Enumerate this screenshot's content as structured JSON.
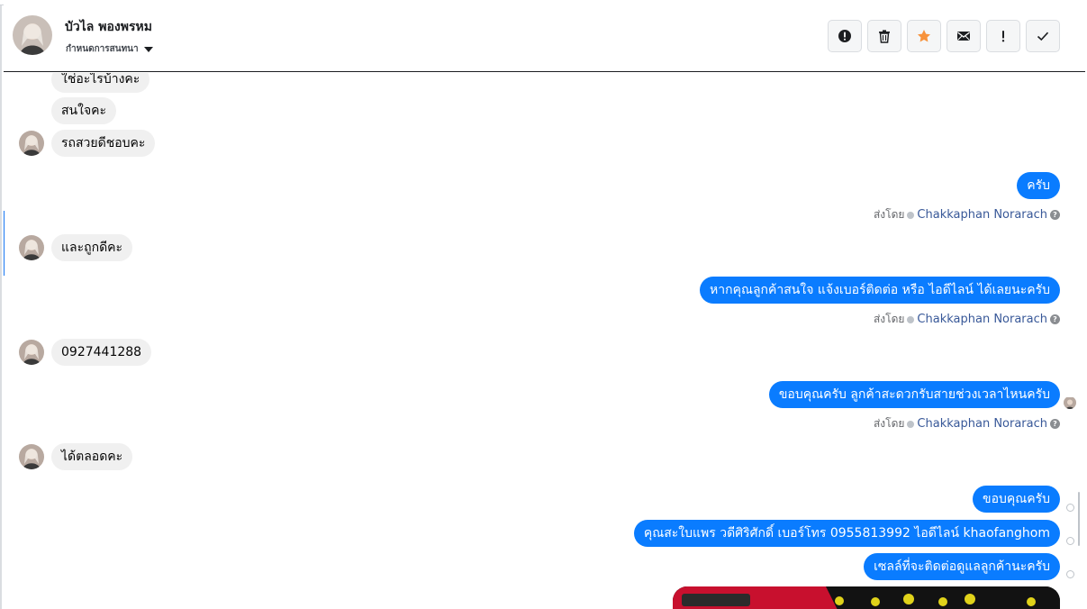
{
  "header": {
    "contact_name": "บัวไล พองพรหม",
    "assign_label": "กำหนดการสนทนา",
    "actions": [
      {
        "name": "spam-button",
        "icon": "alert-circle-icon"
      },
      {
        "name": "delete-button",
        "icon": "trash-icon"
      },
      {
        "name": "star-button",
        "icon": "star-icon",
        "color": "#f7923b"
      },
      {
        "name": "mark-unread-button",
        "icon": "envelope-icon"
      },
      {
        "name": "follow-up-button",
        "icon": "exclamation-icon"
      },
      {
        "name": "mark-done-button",
        "icon": "check-icon"
      }
    ]
  },
  "messages": {
    "in_1": "ใช่อะไรบ้างคะ",
    "in_2": "สนใจคะ",
    "in_3": "รถสวยดีชอบคะ",
    "out_1": "ครับ",
    "in_4": "และถูกดีคะ",
    "out_2": "หากคุณลูกค้าสนใจ แจ้งเบอร์ติดต่อ หรือ ไอดีไลน์ ได้เลยนะครับ",
    "in_5": "0927441288",
    "out_3": "ขอบคุณครับ ลูกค้าสะดวกรับสายช่วงเวลาไหนครับ",
    "in_6": "ได้ตลอดคะ",
    "out_4": "ขอบคุณครับ",
    "out_5": "คุณสะใบแพร วดีศิริศักดิ์ เบอร์โทร 0955813992  ไอดีไลน์  khaofanghom",
    "out_6": "เซลล์ที่จะติดต่อดูแลลูกค้านะครับ"
  },
  "sent_by": {
    "prefix": "ส่งโดย",
    "agent": "Chakkaphan Norarach",
    "help": "?"
  },
  "colors": {
    "accent": "#0a7cff",
    "incoming_bubble": "#f0f0f0",
    "link": "#385898"
  }
}
